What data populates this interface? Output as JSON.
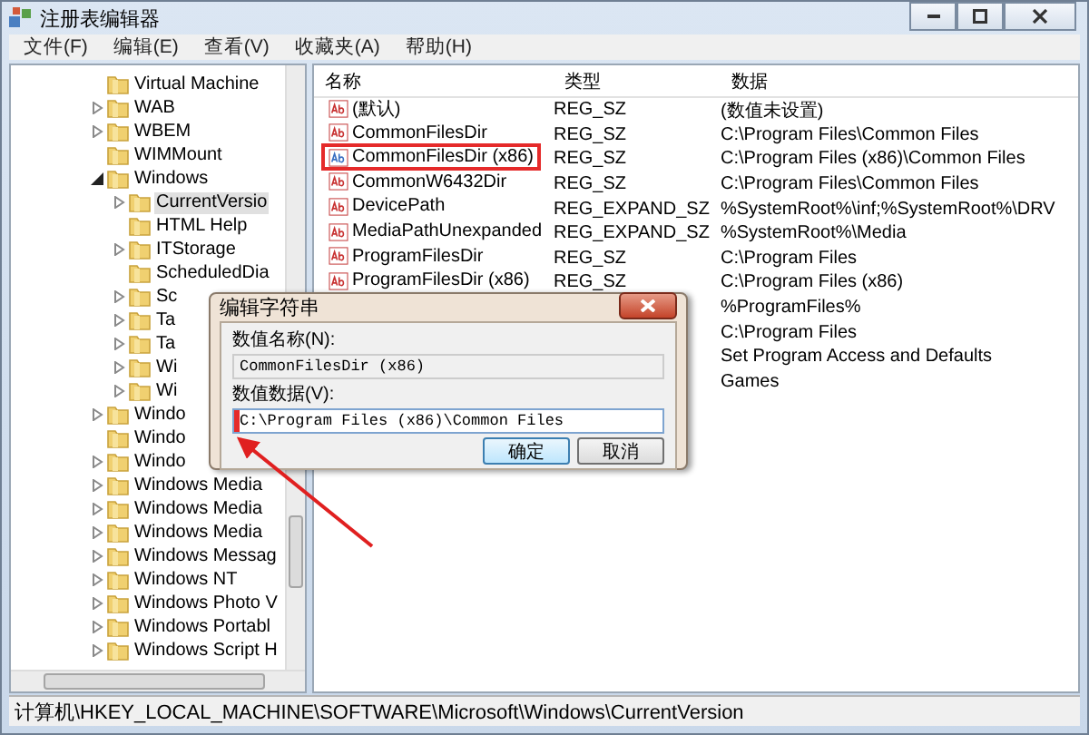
{
  "window": {
    "title": "注册表编辑器"
  },
  "menu": [
    "文件(F)",
    "编辑(E)",
    "查看(V)",
    "收藏夹(A)",
    "帮助(H)"
  ],
  "tree": {
    "items": [
      {
        "label": "Virtual Machine",
        "kind": "leaf",
        "selected": false
      },
      {
        "label": "WAB",
        "kind": "branch",
        "expanded": false,
        "selected": false
      },
      {
        "label": "WBEM",
        "kind": "branch",
        "expanded": false,
        "selected": false
      },
      {
        "label": "WIMMount",
        "kind": "leaf",
        "selected": false
      },
      {
        "label": "Windows",
        "kind": "branch",
        "expanded": true,
        "selected": false,
        "children": [
          {
            "label": "CurrentVersio",
            "kind": "branch",
            "expanded": false,
            "selected": true
          },
          {
            "label": "HTML Help",
            "kind": "leaf",
            "selected": false
          },
          {
            "label": "ITStorage",
            "kind": "branch",
            "expanded": false,
            "selected": false
          },
          {
            "label": "ScheduledDia",
            "kind": "leaf",
            "selected": false
          },
          {
            "label": "Sc",
            "kind": "branch",
            "expanded": false,
            "selected": false
          },
          {
            "label": "Ta",
            "kind": "branch",
            "expanded": false,
            "selected": false
          },
          {
            "label": "Ta",
            "kind": "branch",
            "expanded": false,
            "selected": false
          },
          {
            "label": "Wi",
            "kind": "branch",
            "expanded": false,
            "selected": false
          },
          {
            "label": "Wi",
            "kind": "branch",
            "expanded": false,
            "selected": false
          }
        ]
      },
      {
        "label": "Windo",
        "kind": "branch",
        "expanded": false,
        "selected": false
      },
      {
        "label": "Windo",
        "kind": "leaf",
        "selected": false
      },
      {
        "label": "Windo",
        "kind": "branch",
        "expanded": false,
        "selected": false
      },
      {
        "label": "Windows Media",
        "kind": "branch",
        "expanded": false,
        "selected": false
      },
      {
        "label": "Windows Media",
        "kind": "branch",
        "expanded": false,
        "selected": false
      },
      {
        "label": "Windows Media",
        "kind": "branch",
        "expanded": false,
        "selected": false
      },
      {
        "label": "Windows Messag",
        "kind": "branch",
        "expanded": false,
        "selected": false
      },
      {
        "label": "Windows NT",
        "kind": "branch",
        "expanded": false,
        "selected": false
      },
      {
        "label": "Windows Photo V",
        "kind": "branch",
        "expanded": false,
        "selected": false
      },
      {
        "label": "Windows Portabl",
        "kind": "branch",
        "expanded": false,
        "selected": false
      },
      {
        "label": "Windows Script H",
        "kind": "branch",
        "expanded": false,
        "selected": false
      }
    ]
  },
  "table": {
    "columns": [
      "名称",
      "类型",
      "数据"
    ],
    "rows": [
      {
        "name": "(默认)",
        "type": "REG_SZ",
        "data": "(数值未设置)",
        "outlined": false
      },
      {
        "name": "CommonFilesDir",
        "type": "REG_SZ",
        "data": "C:\\Program Files\\Common Files",
        "outlined": false
      },
      {
        "name": "CommonFilesDir (x86)",
        "type": "REG_SZ",
        "data": "C:\\Program Files (x86)\\Common Files",
        "outlined": true
      },
      {
        "name": "CommonW6432Dir",
        "type": "REG_SZ",
        "data": "C:\\Program Files\\Common Files",
        "outlined": false
      },
      {
        "name": "DevicePath",
        "type": "REG_EXPAND_SZ",
        "data": "%SystemRoot%\\inf;%SystemRoot%\\DRV",
        "outlined": false
      },
      {
        "name": "MediaPathUnexpanded",
        "type": "REG_EXPAND_SZ",
        "data": "%SystemRoot%\\Media",
        "outlined": false
      },
      {
        "name": "ProgramFilesDir",
        "type": "REG_SZ",
        "data": "C:\\Program Files",
        "outlined": false
      },
      {
        "name": "ProgramFilesDir (x86)",
        "type": "REG_SZ",
        "data": "C:\\Program Files (x86)",
        "outlined": false
      },
      {
        "data": "%ProgramFiles%",
        "outlined": false
      },
      {
        "data": "C:\\Program Files",
        "outlined": false
      },
      {
        "data": "Set Program Access and Defaults",
        "outlined": false
      },
      {
        "data": "Games",
        "outlined": false
      }
    ]
  },
  "dialog": {
    "title": "编辑字符串",
    "name_label": "数值名称(N):",
    "name_value": "CommonFilesDir (x86)",
    "data_label": "数值数据(V):",
    "data_value": "C:\\Program Files (x86)\\Common Files",
    "data_outlined": true,
    "buttons": [
      {
        "label": "确定",
        "default": true
      },
      {
        "label": "取消",
        "default": false
      }
    ]
  },
  "annotation_arrow": true,
  "status_bar": "计算机\\HKEY_LOCAL_MACHINE\\SOFTWARE\\Microsoft\\Windows\\CurrentVersion"
}
